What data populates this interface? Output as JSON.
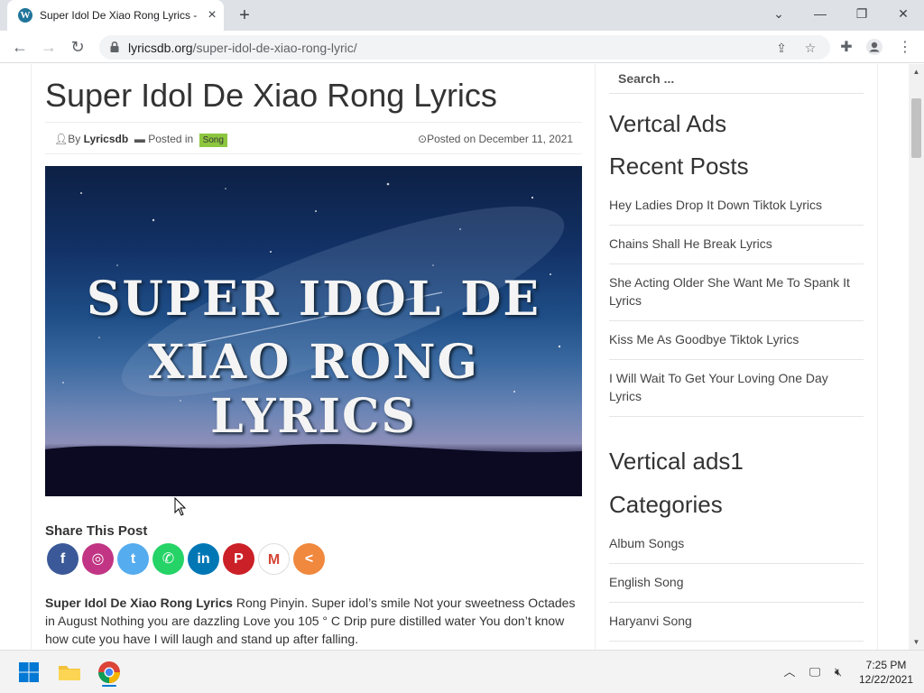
{
  "browser": {
    "tab_title": "Super Idol De Xiao Rong Lyrics - ",
    "url_domain": "lyricsdb.org",
    "url_path": "/super-idol-de-xiao-rong-lyric/"
  },
  "post": {
    "title": "Super Idol De Xiao Rong Lyrics",
    "by_label": "By",
    "author": "Lyricsdb",
    "posted_in_label": "Posted in",
    "category": "Song",
    "posted_on": "Posted on December 11, 2021",
    "hero_line1": "SUPER IDOL DE",
    "hero_line2": "XIAO RONG LYRICS",
    "share_title": "Share This Post",
    "excerpt_bold": "Super Idol De Xiao Rong Lyrics",
    "excerpt_text": " Rong Pinyin. Super idol’s smile Not your sweetness Octades in August Nothing you are dazzling Love you 105 ° C Drip pure distilled water You don’t know how cute you have I will laugh and stand up after falling."
  },
  "share_buttons": [
    {
      "name": "facebook",
      "glyph": "f",
      "color": "#3b5998"
    },
    {
      "name": "instagram",
      "glyph": "◎",
      "color": "#c13584"
    },
    {
      "name": "twitter",
      "glyph": "t",
      "color": "#55acee"
    },
    {
      "name": "whatsapp",
      "glyph": "✆",
      "color": "#25d366"
    },
    {
      "name": "linkedin",
      "glyph": "in",
      "color": "#0077b5"
    },
    {
      "name": "pinterest",
      "glyph": "P",
      "color": "#cb2027"
    },
    {
      "name": "gmail",
      "glyph": "M",
      "color": "#ffffff"
    },
    {
      "name": "more",
      "glyph": "<",
      "color": "#f0883e"
    }
  ],
  "sidebar": {
    "search_placeholder": "Search ...",
    "widget1": "Vertcal Ads",
    "recent_title": "Recent Posts",
    "recent_posts": [
      "Hey Ladies Drop It Down Tiktok Lyrics",
      "Chains Shall He Break Lyrics",
      "She Acting Older She Want Me To Spank It Lyrics",
      "Kiss Me As Goodbye Tiktok Lyrics",
      "I Will Wait To Get Your Loving One Day Lyrics"
    ],
    "widget2": "Vertical ads1",
    "categories_title": "Categories",
    "categories": [
      "Album Songs",
      "English Song",
      "Haryanvi Song"
    ]
  },
  "taskbar": {
    "time": "7:25 PM",
    "date": "12/22/2021"
  }
}
